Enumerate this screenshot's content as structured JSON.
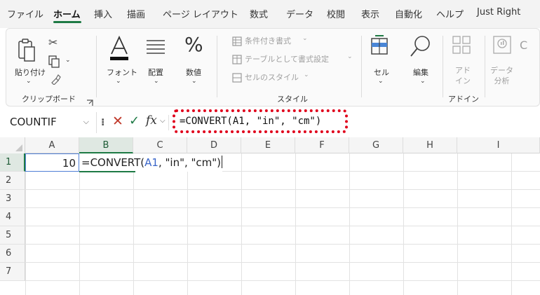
{
  "menu": {
    "tabs": [
      {
        "label": "ファイル",
        "active": false
      },
      {
        "label": "ホーム",
        "active": true
      },
      {
        "label": "挿入",
        "active": false
      },
      {
        "label": "描画",
        "active": false
      },
      {
        "label": "ページ レイアウト",
        "active": false
      },
      {
        "label": "数式",
        "active": false
      },
      {
        "label": "データ",
        "active": false
      },
      {
        "label": "校閲",
        "active": false
      },
      {
        "label": "表示",
        "active": false
      },
      {
        "label": "自動化",
        "active": false
      },
      {
        "label": "ヘルプ",
        "active": false
      },
      {
        "label": "Just Right",
        "active": false
      }
    ]
  },
  "ribbon": {
    "clipboard": {
      "paste_label": "貼り付け",
      "group_label": "クリップボード"
    },
    "font": {
      "label": "フォント"
    },
    "alignment": {
      "label": "配置"
    },
    "number": {
      "label": "数値"
    },
    "styles": {
      "conditional_label": "条件付き書式",
      "table_label": "テーブルとして書式設定",
      "cell_style_label": "セルのスタイル",
      "group_label": "スタイル"
    },
    "cells": {
      "label": "セル"
    },
    "editing": {
      "label": "編集"
    },
    "addins": {
      "button_label": "アド\nイン",
      "group_label": "アドイン"
    },
    "data_analysis": {
      "label": "データ\n分析"
    },
    "colors": {
      "accent": "#1e7a45",
      "highlight": "#e0001b",
      "ref": "#3a66c9"
    }
  },
  "formula_bar": {
    "name_box": "COUNTIF",
    "fx_label": "fx",
    "formula": "=CONVERT(A1, \"in\", \"cm\")"
  },
  "grid": {
    "columns": [
      "A",
      "B",
      "C",
      "D",
      "E",
      "F",
      "G",
      "H",
      "I"
    ],
    "selected_column": "B",
    "rows": [
      "1",
      "2",
      "3",
      "4",
      "5",
      "6",
      "7"
    ],
    "selected_row": "1",
    "cells": {
      "A1": "10",
      "B1_prefix": "=CONVERT(",
      "B1_ref": "A1",
      "B1_suffix": ", \"in\", \"cm\")"
    }
  }
}
